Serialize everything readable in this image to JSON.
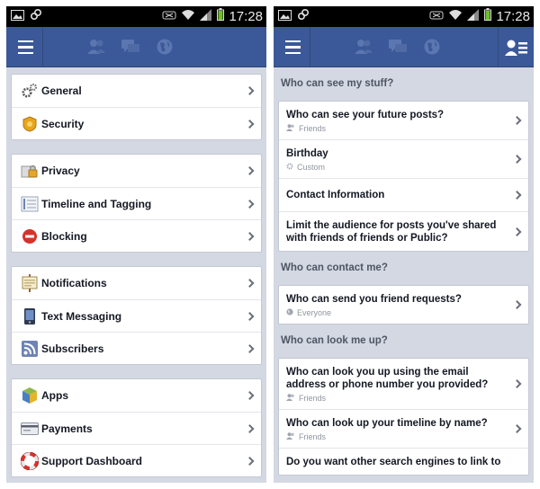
{
  "status_bar": {
    "time": "17:28"
  },
  "colors": {
    "brand": "#3b5998",
    "background": "#d4d8e2"
  },
  "left_screen": {
    "groups": [
      {
        "items": [
          {
            "label": "General",
            "icon": "gear-icon"
          },
          {
            "label": "Security",
            "icon": "badge-icon"
          }
        ]
      },
      {
        "items": [
          {
            "label": "Privacy",
            "icon": "lock-icon"
          },
          {
            "label": "Timeline and Tagging",
            "icon": "timeline-icon"
          },
          {
            "label": "Blocking",
            "icon": "block-icon"
          }
        ]
      },
      {
        "items": [
          {
            "label": "Notifications",
            "icon": "notice-board-icon"
          },
          {
            "label": "Text Messaging",
            "icon": "phone-icon"
          },
          {
            "label": "Subscribers",
            "icon": "rss-icon"
          }
        ]
      },
      {
        "items": [
          {
            "label": "Apps",
            "icon": "cube-icon"
          },
          {
            "label": "Payments",
            "icon": "credit-card-icon"
          },
          {
            "label": "Support Dashboard",
            "icon": "lifebuoy-icon"
          }
        ]
      }
    ]
  },
  "right_screen": {
    "sections": [
      {
        "title": "Who can see my stuff?",
        "items": [
          {
            "title": "Who can see your future posts?",
            "sub": "Friends",
            "sub_icon": "friends-icon"
          },
          {
            "title": "Birthday",
            "sub": "Custom",
            "sub_icon": "gear-small-icon"
          },
          {
            "title": "Contact Information",
            "sub": ""
          },
          {
            "title": "Limit the audience for posts you've shared with friends of friends or Public?",
            "sub": ""
          }
        ]
      },
      {
        "title": "Who can contact me?",
        "items": [
          {
            "title": "Who can send you friend requests?",
            "sub": "Everyone",
            "sub_icon": "globe-icon"
          }
        ]
      },
      {
        "title": "Who can look me up?",
        "items": [
          {
            "title": "Who can look you up using the email address or phone number you provided?",
            "sub": "Friends",
            "sub_icon": "friends-icon"
          },
          {
            "title": "Who can look up your timeline by name?",
            "sub": "Friends",
            "sub_icon": "friends-icon"
          },
          {
            "title": "Do you want other search engines to link to",
            "sub": ""
          }
        ]
      }
    ]
  }
}
